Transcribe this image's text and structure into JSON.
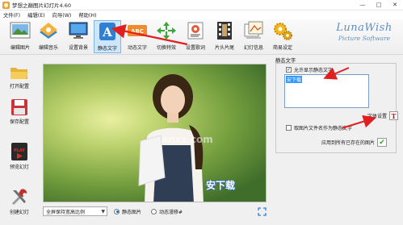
{
  "window": {
    "title": "梦想之巅图片幻灯片4.60",
    "minimize": "—",
    "maximize": "□",
    "close": "✕"
  },
  "menu": {
    "items": [
      "文件(F)",
      "编辑(E)",
      "向导(W)",
      "帮助(H)"
    ]
  },
  "toolbar": {
    "items": [
      {
        "label": "编辑图片",
        "icon": "photo-edit-icon"
      },
      {
        "label": "编辑音乐",
        "icon": "music-edit-icon"
      },
      {
        "label": "设置背景",
        "icon": "monitor-background-icon"
      },
      {
        "label": "静态文字",
        "icon": "static-text-icon",
        "selected": true
      },
      {
        "label": "动态文字",
        "icon": "abc-dynamic-text-icon"
      },
      {
        "label": "切换特效",
        "icon": "transition-arrows-icon"
      },
      {
        "label": "设置歌词",
        "icon": "lyrics-icon"
      },
      {
        "label": "片头片尾",
        "icon": "film-strip-icon"
      },
      {
        "label": "幻灯信息",
        "icon": "slideshow-info-icon"
      },
      {
        "label": "简易设定",
        "icon": "gears-icon"
      }
    ]
  },
  "logo": {
    "line1": "LunaWish",
    "line2": "Picture Software"
  },
  "sidebar": {
    "items": [
      {
        "label": "打开配置",
        "icon": "open-folder-icon"
      },
      {
        "label": "保存配置",
        "icon": "save-disk-icon"
      },
      {
        "label": "预览幻灯",
        "icon": "preview-play-icon"
      },
      {
        "label": "创建幻灯",
        "icon": "create-tools-icon"
      }
    ]
  },
  "preview": {
    "watermark": "安下载",
    "site_mark": "anxz.com"
  },
  "bottom": {
    "scale_mode": "全屏保持宽高比例",
    "radio_static": "静态图片",
    "radio_dynamic": "动态漫移#",
    "static_selected": true
  },
  "panel": {
    "title": "静态文字",
    "allow_display": "允许显示静态文字:",
    "allow_checked": true,
    "text_value": "安下载",
    "font_settings": "字体设置",
    "use_filename": "取图片文件名作为静态文字",
    "use_filename_checked": false,
    "apply_all": "应用到所有已存在的图片"
  },
  "colors": {
    "accent": "#1f6fc5",
    "arrow": "#e02020",
    "selected_bg": "#cde6fb"
  }
}
